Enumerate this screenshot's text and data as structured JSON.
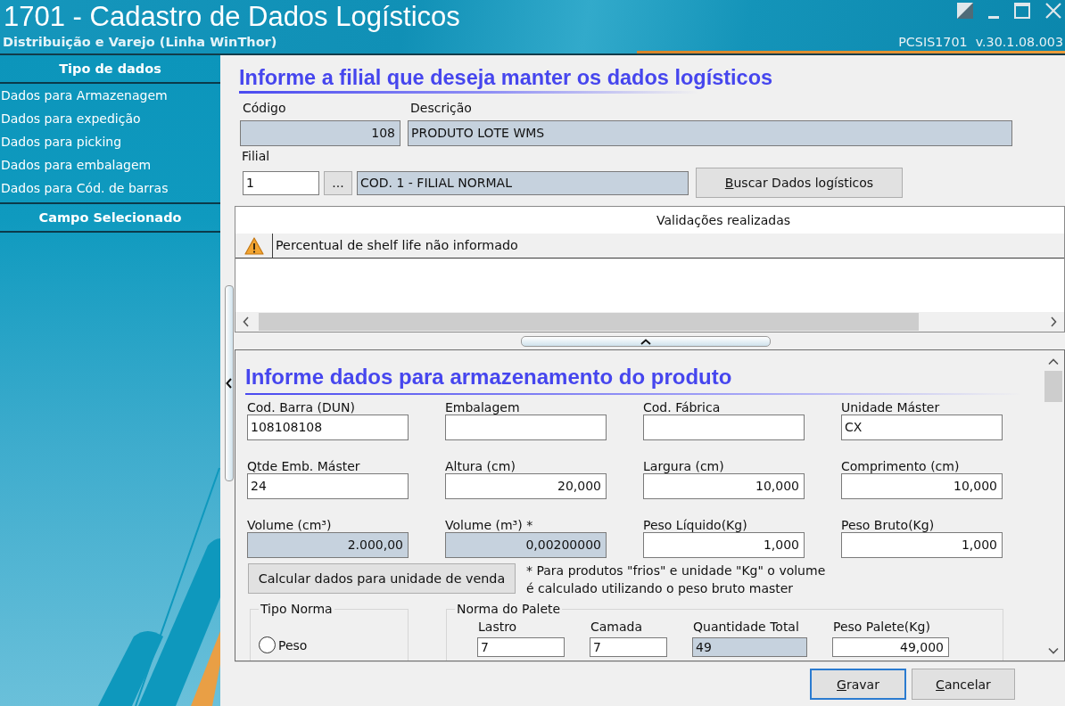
{
  "window": {
    "title": "1701 - Cadastro de Dados Logísticos",
    "subtitle": "Distribuição e Varejo (Linha WinThor)",
    "version": "PCSIS1701  v.30.1.08.003"
  },
  "sidebar": {
    "sections": [
      {
        "title": "Tipo de dados",
        "items": [
          {
            "label": "Dados para Armazenagem",
            "selected": false
          },
          {
            "label": "Dados para expedição",
            "selected": false
          },
          {
            "label": "Dados para picking",
            "selected": false
          },
          {
            "label": "Dados para embalagem",
            "selected": false
          },
          {
            "label": "Dados para Cód. de barras",
            "selected": false
          }
        ]
      },
      {
        "title": "Campo Selecionado"
      }
    ]
  },
  "branch_form": {
    "heading": "Informe a filial que deseja manter os dados logísticos",
    "code": {
      "label": "Código",
      "value": "108",
      "kind": "number",
      "readonly": true
    },
    "description": {
      "label": "Descrição",
      "value": "PRODUTO LOTE WMS",
      "readonly": true
    },
    "branch": {
      "label": "Filial",
      "value": "1",
      "readonly": false
    },
    "lookup_button": "...",
    "branch_name": {
      "value": "COD. 1 - FILIAL NORMAL",
      "readonly": true
    },
    "search_button": {
      "access_key": "B",
      "rest": "uscar Dados logísticos",
      "default": false
    }
  },
  "validations": {
    "column": "Validações realizadas",
    "rows": [
      {
        "kind": "warning",
        "message": "Percentual de shelf life não informado",
        "selected": true
      }
    ]
  },
  "storage_form": {
    "heading": "Informe dados para armazenamento do produto",
    "fields": [
      {
        "label": "Cod. Barra (DUN)",
        "value": "108108108",
        "kind": "text",
        "readonly": false
      },
      {
        "label": "Embalagem",
        "kind": "text",
        "readonly": false
      },
      {
        "label": "Cod. Fábrica",
        "kind": "text",
        "readonly": false
      },
      {
        "label": "Unidade Máster",
        "value": "CX",
        "kind": "text",
        "readonly": false
      },
      {
        "label": "Qtde Emb. Máster",
        "value": "24",
        "kind": "text",
        "readonly": false
      },
      {
        "label": "Altura (cm)",
        "value": "20,000",
        "kind": "number",
        "readonly": false
      },
      {
        "label": "Largura (cm)",
        "value": "10,000",
        "kind": "number",
        "readonly": false
      },
      {
        "label": "Comprimento (cm)",
        "value": "10,000",
        "kind": "number",
        "readonly": false
      },
      {
        "label": "Volume (cm³)",
        "value": "2.000,00",
        "kind": "number",
        "readonly": true
      },
      {
        "label": "Volume (m³) *",
        "value": "0,00200000",
        "kind": "number",
        "readonly": true
      },
      {
        "label": "Peso Líquido(Kg)",
        "value": "1,000",
        "kind": "number",
        "readonly": false
      },
      {
        "label": "Peso Bruto(Kg)",
        "value": "1,000",
        "kind": "number",
        "readonly": false
      }
    ],
    "calc_button": "Calcular dados para unidade de venda",
    "note": "* Para produtos \"frios\" e unidade \"Kg\" o volume\né calculado utilizando o peso bruto master",
    "norm_type": {
      "title": "Tipo Norma",
      "options": [
        {
          "label": "Peso",
          "selected": false
        }
      ]
    },
    "pallet_norm": {
      "title": "Norma do Palete",
      "fields": [
        {
          "label": "Lastro",
          "value": "7",
          "kind": "text",
          "readonly": false
        },
        {
          "label": "Camada",
          "value": "7",
          "kind": "text",
          "readonly": false
        },
        {
          "label": "Quantidade Total",
          "value": "49",
          "kind": "text",
          "readonly": true
        },
        {
          "label": "Peso Palete(Kg)",
          "value": "49,000",
          "kind": "number",
          "readonly": false
        }
      ]
    }
  },
  "footer": {
    "buttons": [
      {
        "access_key": "G",
        "rest": "ravar",
        "default": true
      },
      {
        "access_key": "C",
        "rest": "ancelar",
        "default": false
      }
    ]
  }
}
